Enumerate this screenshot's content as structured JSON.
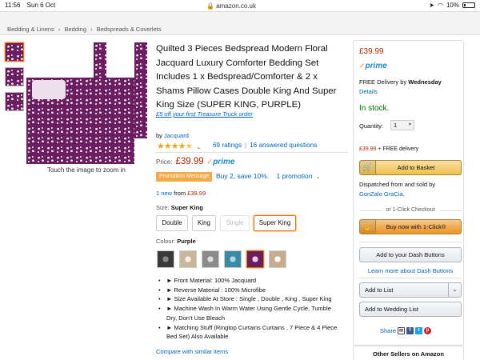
{
  "status_bar": {
    "time": "11:56",
    "date": "Sun 6 Oct",
    "url": "amazon.co.uk",
    "battery": "10%"
  },
  "breadcrumb": {
    "items": [
      "Bedding & Linens",
      "Bedding",
      "Bedspreads & Coverlets"
    ],
    "separator": "›"
  },
  "gallery": {
    "zoom_hint": "Touch the image to zoom in"
  },
  "product": {
    "title": "Quilted 3 Pieces Bedspread Modern Floral Jacquard Luxury Comforter Bedding Set Includes 1 x Bedspread/Comforter & 2 x Shams Pillow Cases Double King And Super King Size (SUPER KING, PURPLE)",
    "truck_offer": "£5 off your first Treasure Truck order",
    "by_prefix": "by",
    "brand": "Jacquard",
    "rating_stars": 4.5,
    "ratings_count": "69 ratings",
    "answered_questions": "16 answered questions",
    "price_label": "Price:",
    "price": "£39.99",
    "prime_label": "prime",
    "promo_badge": "Promotion Message",
    "promo_text": "Buy 2, save 10%.",
    "promo_count": "1 promotion",
    "new_from_count": "1 new",
    "new_from_label": "from",
    "new_from_price": "£39.99",
    "size_label": "Size:",
    "size_selected": "Super King",
    "size_options": [
      "Double",
      "King",
      "Single",
      "Super King"
    ],
    "colour_label": "Colour:",
    "colour_selected": "Purple",
    "bullets": [
      "► Front Material: 100% Jacquard",
      "► Reverse Material : 100% Microfibe",
      "► Size Available At Store : Single , Double , King , Super King",
      "► Machine Wash In Warm Water Using Gentle Cycle, Tumble Dry, Don't Use Bleach",
      "► Matching Stuff (Ringtop Curtains Curtains , 7 Piece & 4 Piece Bed Set) Also Available"
    ],
    "compare_link": "Compare with similar items"
  },
  "buy_box": {
    "price": "£39.99",
    "prime_label": "prime",
    "delivery_prefix": "FREE Delivery by",
    "delivery_day": "Wednesday",
    "details_link": "Details",
    "stock": "In stock.",
    "quantity_label": "Quantity:",
    "quantity_value": "1",
    "ship_price": "£39.99",
    "ship_suffix": "+ FREE delivery",
    "add_to_basket": "Add to Basket",
    "dispatched_text": "Dispatched from and sold by",
    "seller": "GonZalo GraCia",
    "seller_suffix": ".",
    "one_click_label": "or 1-Click Checkout",
    "buy_now": "Buy now with 1-Click®",
    "dash_button": "Add to your Dash Buttons",
    "learn_dash": "Learn more about Dash Buttons",
    "add_to_list": "Add to List",
    "wedding_list": "Add to Wedding List",
    "share_label": "Share",
    "other_sellers": "Other Sellers on Amazon"
  },
  "colors": {
    "link": "#0066c0",
    "price_red": "#b12704",
    "in_stock_green": "#007600",
    "selected_orange": "#e77600"
  }
}
